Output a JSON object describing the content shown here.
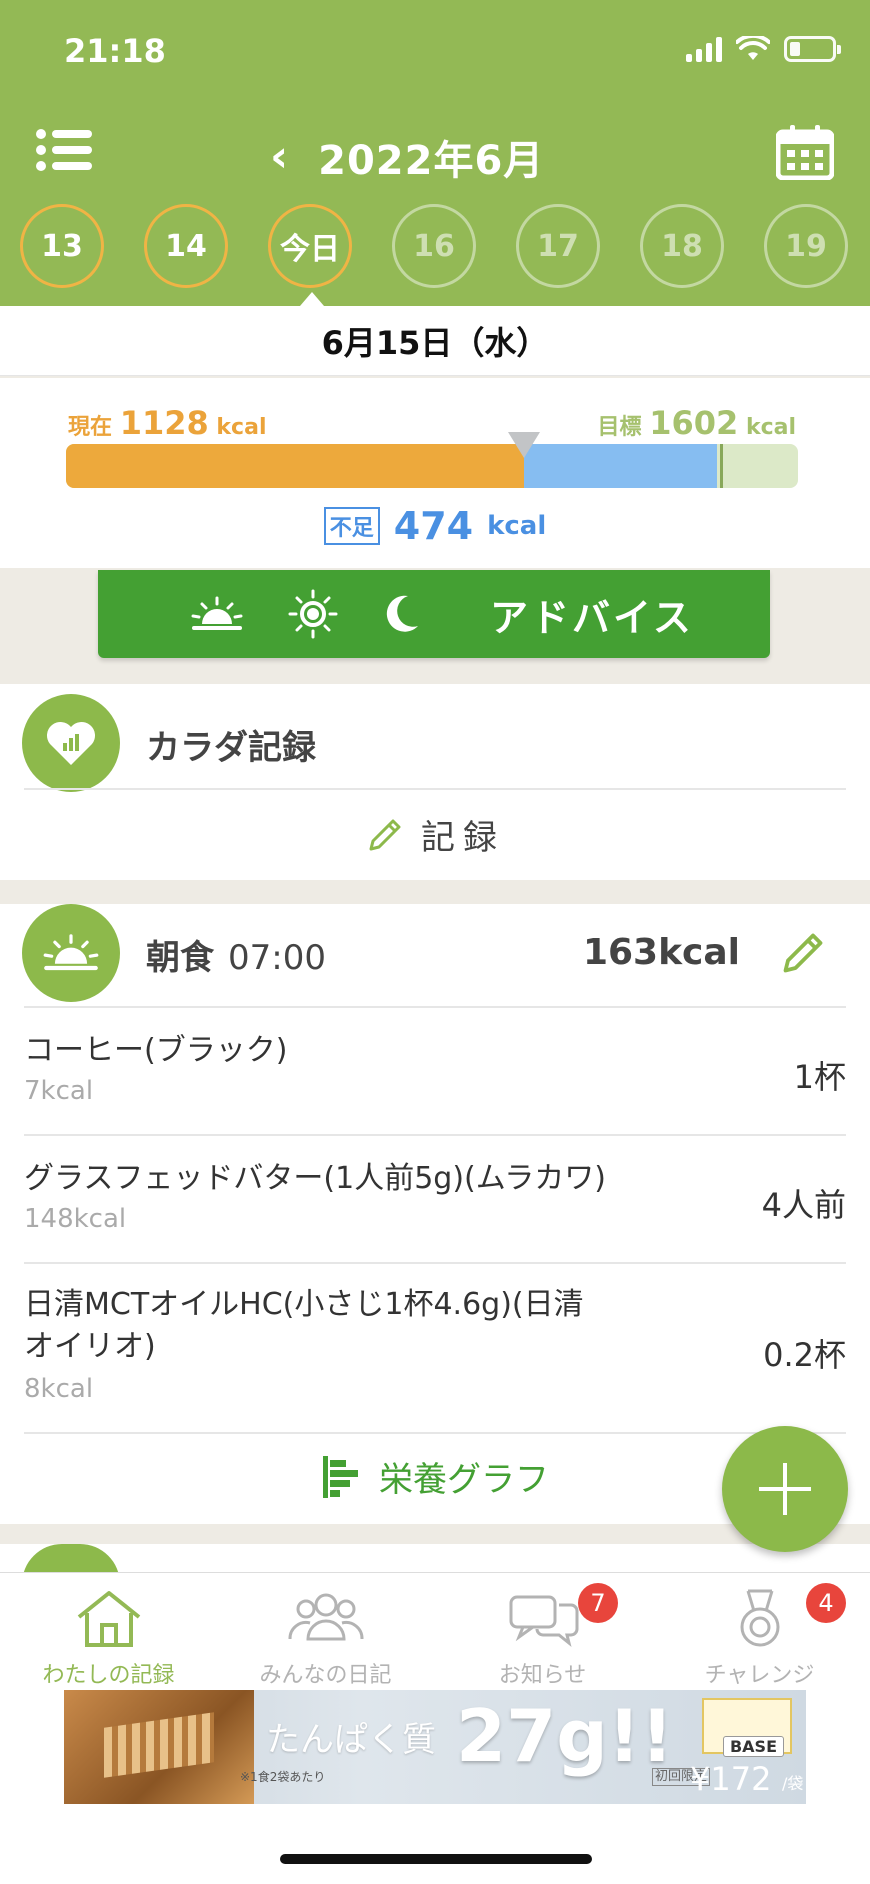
{
  "status_bar": {
    "time": "21:18"
  },
  "header": {
    "month_title": "2022年6月",
    "prev_chevron": "‹",
    "days": [
      "13",
      "14",
      "今日",
      "16",
      "17",
      "18",
      "19"
    ],
    "selected_date": "6月15日（水）"
  },
  "kcal": {
    "current_label": "現在",
    "current_value": "1128",
    "unit": "kcal",
    "target_label": "目標",
    "target_value": "1602",
    "shortage_label": "不足",
    "shortage_value": "474",
    "current_fraction": 0.704,
    "shortage_fraction": 0.296
  },
  "advice": {
    "label": "アドバイス"
  },
  "body_record": {
    "title": "カラダ記録",
    "record_label": "記録"
  },
  "breakfast": {
    "title": "朝食",
    "time": "07:00",
    "kcal": "163kcal",
    "items": [
      {
        "name": "コーヒー(ブラック)",
        "kcal": "7kcal",
        "qty": "1杯"
      },
      {
        "name": "グラスフェッドバター(1人前5g)(ムラカワ)",
        "kcal": "148kcal",
        "qty": "4人前"
      },
      {
        "name": "日清MCTオイルHC(小さじ1杯4.6g)(日清オイリオ)",
        "kcal": "8kcal",
        "qty": "0.2杯"
      }
    ],
    "nutrition_link": "栄養グラフ"
  },
  "tabs": [
    {
      "label": "わたしの記録",
      "active": true,
      "icon": "house-icon"
    },
    {
      "label": "みんなの日記",
      "active": false,
      "icon": "people-icon"
    },
    {
      "label": "お知らせ",
      "active": false,
      "icon": "chat-icon",
      "badge": "7"
    },
    {
      "label": "チャレンジ",
      "active": false,
      "icon": "medal-icon",
      "badge": "4"
    }
  ],
  "ad": {
    "headline": "たんぱく質",
    "big": "27g!!",
    "note": "※1食2袋あたり",
    "brand": "BASE",
    "first_label": "初回限定",
    "price": "¥172",
    "per": "/袋"
  },
  "colors": {
    "header_green": "#93b955",
    "accent_green": "#44a033",
    "current_orange": "#eda93c",
    "shortage_blue": "#4a90e2",
    "badge_red": "#e8453c"
  }
}
